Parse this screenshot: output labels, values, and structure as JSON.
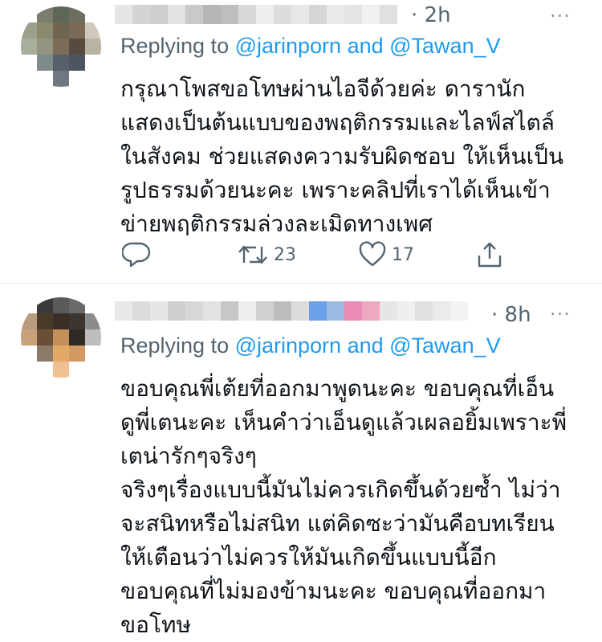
{
  "tweets": [
    {
      "time": "· 2h",
      "more_label": "···",
      "replying_prefix": "Replying to ",
      "handle_1": "@jarinporn",
      "joiner": " and ",
      "handle_2": "@Tawan_V",
      "lines": [
        "กรุณาโพสขอโทษผ่านไอจีด้วยค่ะ ดารานัก",
        "แสดงเป็นต้นแบบของพฤติกรรมและไลฟ์สไตล์",
        "ในสังคม ช่วยแสดงความรับผิดชอบ ให้เห็นเป็น",
        "รูปธรรมด้วยนะคะ เพราะคลิปที่เราได้เห็นเข้า",
        "ข่ายพฤติกรรมล่วงละเมิดทางเพศ"
      ],
      "actions": {
        "reply_icon": "reply-icon",
        "retweet_icon": "retweet-icon",
        "retweet_count": "23",
        "like_icon": "heart-icon",
        "like_count": "17",
        "share_icon": "share-icon"
      }
    },
    {
      "time": "· 8h",
      "more_label": "···",
      "replying_prefix": "Replying to ",
      "handle_1": "@jarinporn",
      "joiner": " and ",
      "handle_2": "@Tawan_V",
      "lines": [
        "ขอบคุณพี่เต้ยที่ออกมาพูดนะคะ ขอบคุณที่เอ็น",
        "ดูพี่เตนะคะ เห็นคำว่าเอ็นดูแล้วเผลอยิ้มเพราะพี่",
        "เตน่ารักๆจริงๆ",
        "จริงๆเรื่องแบบนี้มันไม่ควรเกิดขึ้นด้วยซ้ำ ไม่ว่า",
        "จะสนิทหรือไม่สนิท แต่คิดซะว่ามันคือบทเรียน",
        "ให้เตือนว่าไม่ควรให้มันเกิดขึ้นแบบนี้อีก",
        "ขอบคุณที่ไม่มองข้ามนะคะ ขอบคุณที่ออกมา",
        "ขอโทษ"
      ]
    }
  ],
  "colors": {
    "text": "#0f1419",
    "secondary": "#536471",
    "link": "#1d9bf0",
    "divider": "#e1e8ed"
  }
}
